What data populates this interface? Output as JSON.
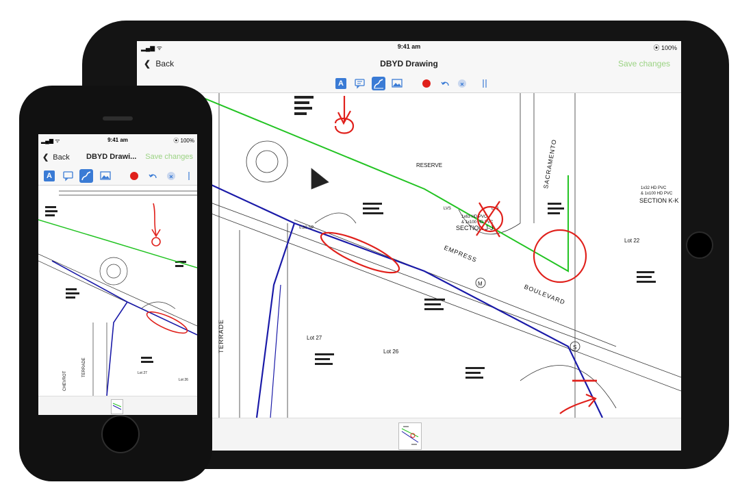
{
  "tablet": {
    "status": {
      "signal": "▂▄▆ ᯤ",
      "time": "9:41 am",
      "battery": "⦿ 100%"
    },
    "nav": {
      "back_label": "Back",
      "title": "DBYD Drawing",
      "save_label": "Save changes"
    },
    "toolbar": {
      "text_tool_glyph": "A"
    },
    "drawing": {
      "labels": {
        "reserve": "RESERVE",
        "section_jj": "SECTION J-J",
        "section_kk": "SECTION K-K",
        "empress": "EMPRESS",
        "boulevard": "BOULEVARD",
        "sacramento": "SACRAMENTO",
        "terrade": "TERRADE",
        "lot22": "Lot 22",
        "lot26": "Lot 26",
        "lot27": "Lot 27",
        "m_marker": "M",
        "s_marker": "S",
        "sp": "0.80 SP",
        "pvc1": "1x63 HD PVC",
        "pvc2": "& 1x100 HD PVC",
        "pvc3": "1x32 HD PVC",
        "pvc4": "& 1x100 HD PVC",
        "lv3": "LV3",
        "lvs": "LVS"
      }
    }
  },
  "phone": {
    "status": {
      "signal": "▂▄▆ ᯤ",
      "time": "9:41 am",
      "battery": "⦿ 100%"
    },
    "nav": {
      "back_label": "Back",
      "title": "DBYD Drawi...",
      "save_label": "Save changes"
    },
    "toolbar": {
      "text_tool_glyph": "A"
    },
    "drawing": {
      "labels": {
        "terrade": "TERRADE",
        "lot26": "Lot 26",
        "lot27": "Lot 27",
        "chevrot": "CHEVROT"
      }
    }
  },
  "colors": {
    "accent_blue": "#3a7bd5",
    "save_green": "#9bd383",
    "markup_red": "#e0201b",
    "cable_green": "#22c322",
    "cable_blue": "#1a1aa8"
  }
}
